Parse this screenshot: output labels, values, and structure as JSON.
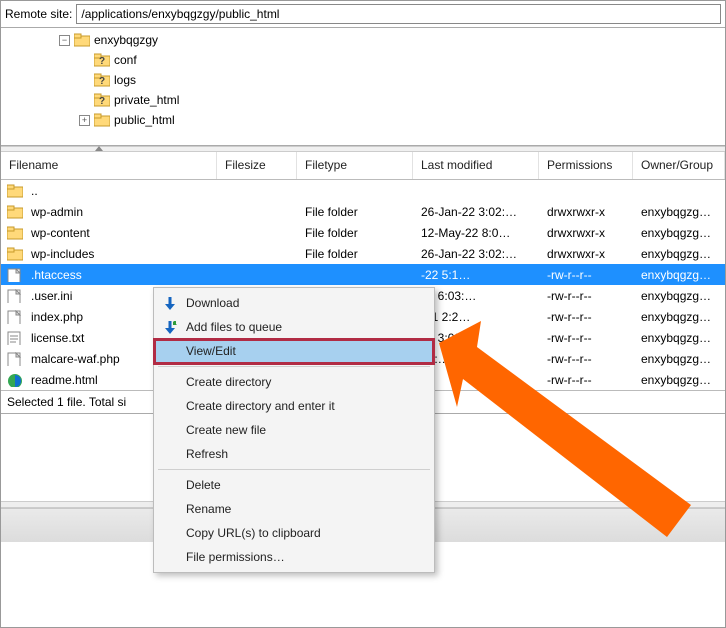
{
  "topbar": {
    "label": "Remote site:",
    "path": "/applications/enxybqgzgy/public_html"
  },
  "tree": {
    "root": "enxybqgzgy",
    "children": [
      {
        "name": "conf",
        "unknown": true
      },
      {
        "name": "logs",
        "unknown": true
      },
      {
        "name": "private_html",
        "unknown": true
      },
      {
        "name": "public_html",
        "unknown": false,
        "expandable": true
      }
    ]
  },
  "columns": {
    "name": "Filename",
    "size": "Filesize",
    "type": "Filetype",
    "modified": "Last modified",
    "perm": "Permissions",
    "owner": "Owner/Group"
  },
  "rows": [
    {
      "icon": "folder",
      "name": "..",
      "size": "",
      "type": "",
      "modified": "",
      "perm": "",
      "owner": ""
    },
    {
      "icon": "folder",
      "name": "wp-admin",
      "size": "",
      "type": "File folder",
      "modified": "26-Jan-22 3:02:…",
      "perm": "drwxrwxr-x",
      "owner": "enxybqgzgy…"
    },
    {
      "icon": "folder",
      "name": "wp-content",
      "size": "",
      "type": "File folder",
      "modified": "12-May-22 8:0…",
      "perm": "drwxrwxr-x",
      "owner": "enxybqgzgy…"
    },
    {
      "icon": "folder",
      "name": "wp-includes",
      "size": "",
      "type": "File folder",
      "modified": "26-Jan-22 3:02:…",
      "perm": "drwxrwxr-x",
      "owner": "enxybqgzgy…"
    },
    {
      "icon": "file",
      "name": ".htaccess",
      "size": "",
      "type": "",
      "modified": "-22 5:1…",
      "perm": "-rw-r--r--",
      "owner": "enxybqgzgy…",
      "selected": true
    },
    {
      "icon": "file",
      "name": ".user.ini",
      "size": "",
      "type": "",
      "modified": "22 6:03:…",
      "perm": "-rw-r--r--",
      "owner": "enxybqgzgy…"
    },
    {
      "icon": "file",
      "name": "index.php",
      "size": "",
      "type": "",
      "modified": "-21 2:2…",
      "perm": "-rw-r--r--",
      "owner": "enxybqgzgy…"
    },
    {
      "icon": "file-text",
      "name": "license.txt",
      "size": "",
      "type": "",
      "modified": "22 3:02:…",
      "perm": "-rw-r--r--",
      "owner": "enxybqgzgy…"
    },
    {
      "icon": "file",
      "name": "malcare-waf.php",
      "size": "",
      "type": "",
      "modified": "03:…",
      "perm": "-rw-r--r--",
      "owner": "enxybqgzgy…"
    },
    {
      "icon": "edge",
      "name": "readme.html",
      "size": "",
      "type": "",
      "modified": "",
      "perm": "-rw-r--r--",
      "owner": "enxybqgzgy…"
    }
  ],
  "status": "Selected 1 file. Total si",
  "contextMenu": {
    "items": [
      {
        "label": "Download",
        "icon": "dl"
      },
      {
        "label": "Add files to queue",
        "icon": "dlq"
      },
      {
        "label": "View/Edit",
        "highlight": true
      },
      "sep",
      {
        "label": "Create directory"
      },
      {
        "label": "Create directory and enter it"
      },
      {
        "label": "Create new file"
      },
      {
        "label": "Refresh"
      },
      "sep",
      {
        "label": "Delete"
      },
      {
        "label": "Rename"
      },
      {
        "label": "Copy URL(s) to clipboard"
      },
      {
        "label": "File permissions…"
      }
    ]
  }
}
